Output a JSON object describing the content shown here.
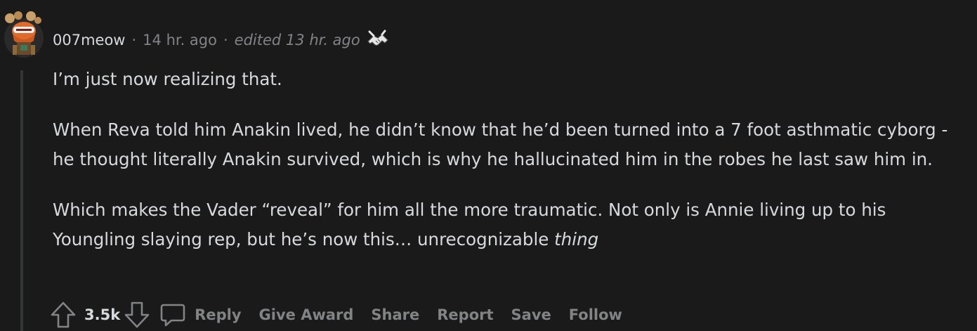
{
  "comment": {
    "author": "007meow",
    "separator": "·",
    "time": "14 hr. ago",
    "edited": "edited 13 hr. ago",
    "paragraphs": {
      "p1": "I’m just now realizing that.",
      "p2": "When Reva told him Anakin lived, he didn’t know that he’d been turned into a 7 foot asthmatic cyborg - he thought literally Anakin survived, which is why he hallucinated him in the robes he last saw him in.",
      "p3_main": "Which makes the Vader “reveal” for him all the more traumatic. Not only is Annie living up to his Youngling slaying rep, but he’s now this… unrecognizable ",
      "p3_emphasis": "thing"
    },
    "score": "3.5k"
  },
  "actions": {
    "reply": "Reply",
    "give_award": "Give Award",
    "share": "Share",
    "report": "Report",
    "save": "Save",
    "follow": "Follow"
  },
  "icons": {
    "avatar": "snoo-avatar",
    "award": "handshake-award-icon",
    "upvote": "upvote-arrow-icon",
    "downvote": "downvote-arrow-icon",
    "reply": "comment-bubble-icon"
  },
  "colors": {
    "background": "#1a1a1b",
    "text": "#d7dadc",
    "muted": "#818384",
    "thread_line": "#343536"
  }
}
